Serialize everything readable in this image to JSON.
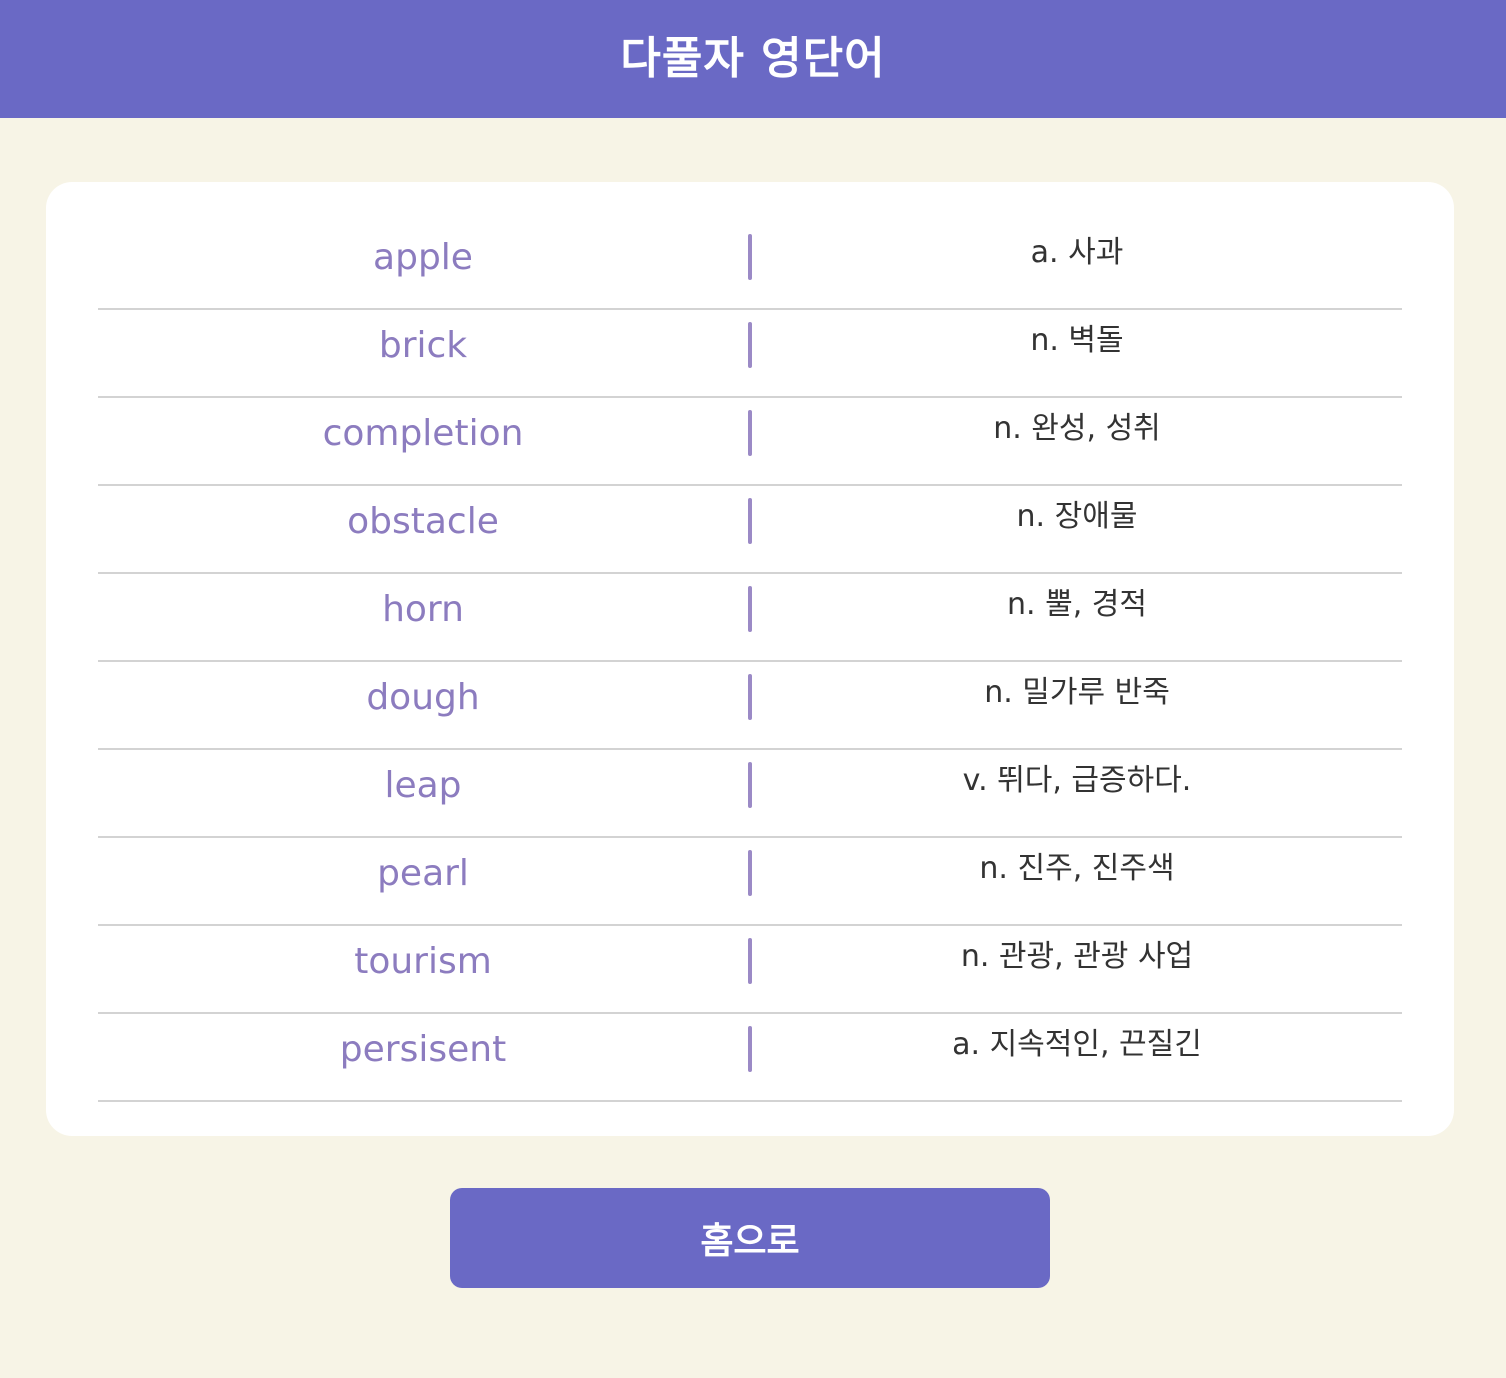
{
  "header": {
    "title": "다풀자 영단어"
  },
  "words": [
    {
      "en": "apple",
      "ko": "a. 사과"
    },
    {
      "en": "brick",
      "ko": "n. 벽돌"
    },
    {
      "en": "completion",
      "ko": "n. 완성, 성취"
    },
    {
      "en": "obstacle",
      "ko": "n. 장애물"
    },
    {
      "en": "horn",
      "ko": "n. 뿔, 경적"
    },
    {
      "en": "dough",
      "ko": "n. 밀가루 반죽"
    },
    {
      "en": "leap",
      "ko": "v. 뛰다, 급증하다."
    },
    {
      "en": "pearl",
      "ko": "n. 진주, 진주색"
    },
    {
      "en": "tourism",
      "ko": "n. 관광, 관광 사업"
    },
    {
      "en": "persisent",
      "ko": "a. 지속적인, 끈질긴"
    }
  ],
  "footer": {
    "home_label": "홈으로"
  },
  "colors": {
    "accent": "#6a69c5",
    "background": "#f7f4e6",
    "word_text": "#8c7cbf",
    "divider": "#9b8ac6"
  }
}
